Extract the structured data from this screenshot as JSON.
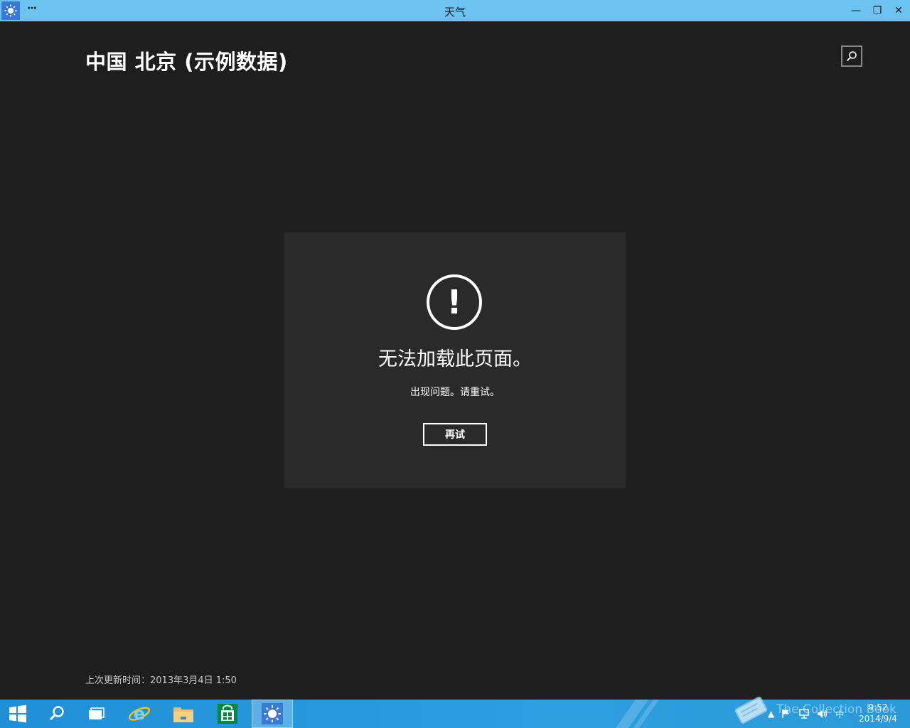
{
  "window": {
    "title": "天气",
    "more_label": "···",
    "minimize_label": "—",
    "maximize_label": "❐",
    "close_label": "✕"
  },
  "header": {
    "title": "中国 北京 (示例数据)"
  },
  "error": {
    "title": "无法加载此页面。",
    "message": "出现问题。请重试。",
    "retry_label": "再试",
    "icon_glyph": "!"
  },
  "footer": {
    "last_updated": "上次更新时间：2013年3月4日 1:50"
  },
  "taskbar": {
    "items": [
      "start",
      "search",
      "task-view",
      "internet-explorer",
      "file-explorer",
      "store",
      "weather"
    ],
    "active_item": "weather",
    "tray": {
      "ime_label": "中",
      "time": "9:52",
      "date": "2014/9/4"
    },
    "watermark": "The Collection Book"
  },
  "colors": {
    "titlebar": "#6cc3f0",
    "background": "#1e1e1e",
    "card": "#2a2a2a",
    "taskbar": "#2d9ee0"
  }
}
